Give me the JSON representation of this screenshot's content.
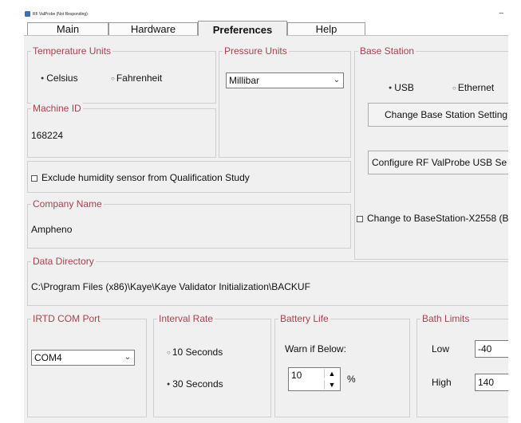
{
  "window": {
    "title": "RF ValProbe (Not Responding)"
  },
  "tabs": [
    {
      "label": "Main"
    },
    {
      "label": "Hardware"
    },
    {
      "label": "Preferences"
    },
    {
      "label": "Help"
    }
  ],
  "temperature": {
    "title": "Temperature Units",
    "options": [
      {
        "label": "Celsius",
        "selected": true
      },
      {
        "label": "Fahrenheit",
        "selected": false
      }
    ]
  },
  "pressure": {
    "title": "Pressure Units",
    "value": "Millibar"
  },
  "base_station": {
    "title": "Base Station",
    "options": [
      {
        "label": "USB",
        "selected": true
      },
      {
        "label": "Ethernet",
        "selected": false
      }
    ],
    "change_settings_label": "Change Base Station Setting",
    "configure_label": "Configure RF ValProbe USB Se",
    "change_to_label": "Change to BaseStation-X2558 (B"
  },
  "machine": {
    "title": "Machine ID",
    "value": "168224"
  },
  "humidity": {
    "label": "Exclude humidity sensor from Qualification Study",
    "checked": false
  },
  "company": {
    "title": "Company Name",
    "value": "Ampheno"
  },
  "data_directory": {
    "title": "Data Directory",
    "value": "C:\\Program Files (x86)\\Kaye\\Kaye Validator Initialization\\BACKUF"
  },
  "irtd": {
    "title": "IRTD COM Port",
    "value": "COM4"
  },
  "interval": {
    "title": "Interval Rate",
    "options": [
      {
        "label": "10 Seconds",
        "selected": false
      },
      {
        "label": "30 Seconds",
        "selected": true
      }
    ]
  },
  "battery": {
    "title": "Battery Life",
    "warn_label": "Warn if Below:",
    "value": "10",
    "unit": "%"
  },
  "bath": {
    "title": "Bath Limits",
    "low_label": "Low",
    "low_value": "-40",
    "high_label": "High",
    "high_value": "140"
  },
  "colors": {
    "group_title": "#a6434d",
    "window_bg": "#f0f0f0"
  }
}
